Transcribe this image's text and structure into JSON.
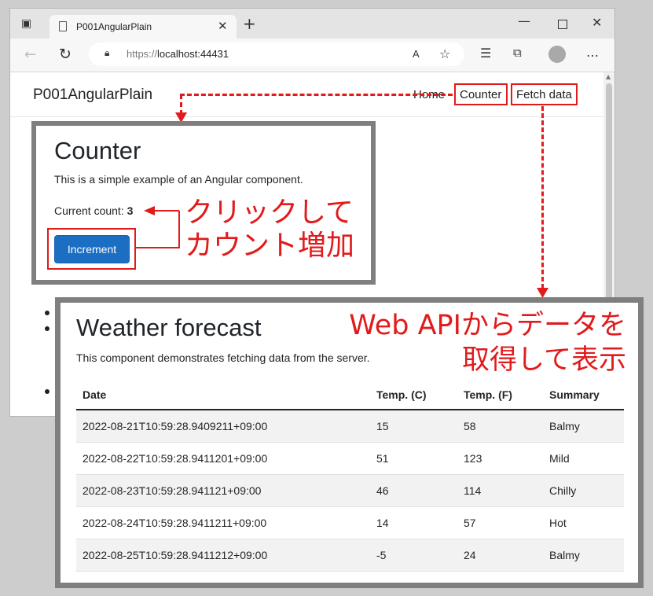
{
  "browser": {
    "tab_title": "P001AngularPlain",
    "url_scheme": "https://",
    "url_host": "localhost:44431"
  },
  "app": {
    "brand": "P001AngularPlain",
    "nav": {
      "home": "Home",
      "counter": "Counter",
      "fetch": "Fetch data"
    }
  },
  "counter": {
    "title": "Counter",
    "description": "This is a simple example of an Angular component.",
    "count_label": "Current count: ",
    "count_value": "3",
    "button_label": "Increment"
  },
  "weather": {
    "title": "Weather forecast",
    "description": "This component demonstrates fetching data from the server.",
    "columns": [
      "Date",
      "Temp. (C)",
      "Temp. (F)",
      "Summary"
    ],
    "rows": [
      [
        "2022-08-21T10:59:28.9409211+09:00",
        "15",
        "58",
        "Balmy"
      ],
      [
        "2022-08-22T10:59:28.9411201+09:00",
        "51",
        "123",
        "Mild"
      ],
      [
        "2022-08-23T10:59:28.941121+09:00",
        "46",
        "114",
        "Chilly"
      ],
      [
        "2022-08-24T10:59:28.9411211+09:00",
        "14",
        "57",
        "Hot"
      ],
      [
        "2022-08-25T10:59:28.9411212+09:00",
        "-5",
        "24",
        "Balmy"
      ]
    ]
  },
  "annotations": {
    "click_line1": "クリックして",
    "click_line2": "カウント増加",
    "api_line1": "Web APIからデータを",
    "api_line2": "取得して表示"
  },
  "colors": {
    "annotation": "#e11b1b",
    "button": "#1b6ec2",
    "panel_border": "#7f7f7f"
  }
}
